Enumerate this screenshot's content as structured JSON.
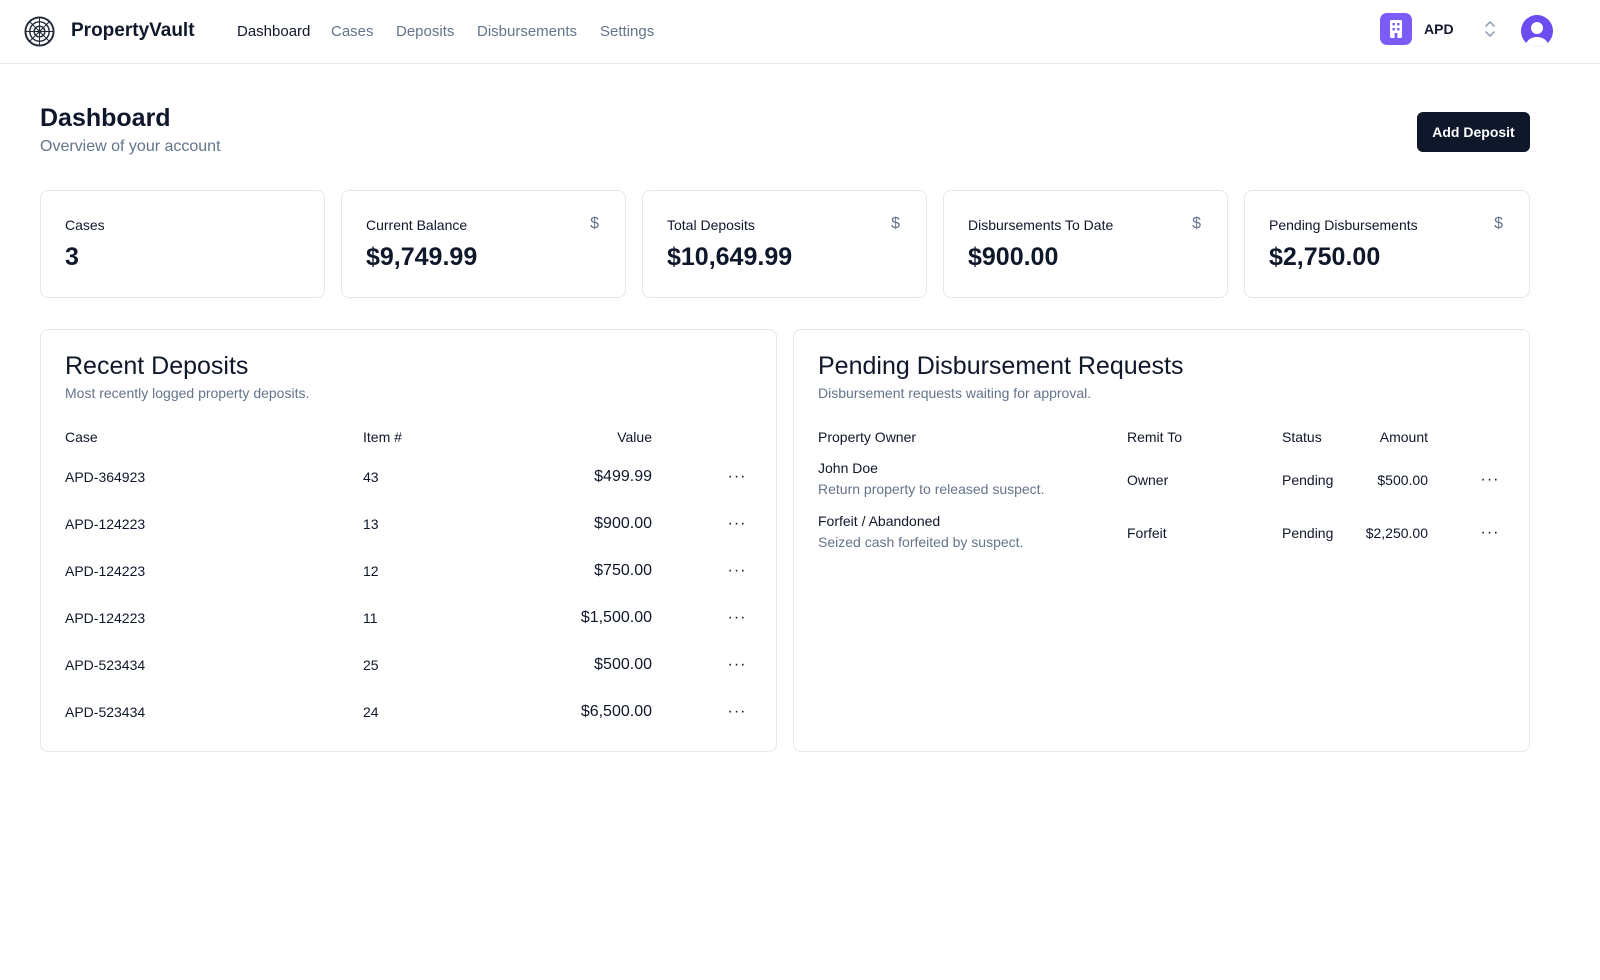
{
  "app": {
    "brand": "PropertyVault"
  },
  "nav": [
    {
      "label": "Dashboard"
    },
    {
      "label": "Cases"
    },
    {
      "label": "Deposits"
    },
    {
      "label": "Disbursements"
    },
    {
      "label": "Settings"
    }
  ],
  "org": {
    "name": "APD",
    "icon": "building-icon"
  },
  "page": {
    "title": "Dashboard",
    "subtitle": "Overview of your account",
    "add_button": "Add Deposit"
  },
  "stats": [
    {
      "label": "Cases",
      "value": "3"
    },
    {
      "label": "Current Balance",
      "value": "$9,749.99",
      "icon": "$"
    },
    {
      "label": "Total Deposits",
      "value": "$10,649.99",
      "icon": "$"
    },
    {
      "label": "Disbursements To Date",
      "value": "$900.00",
      "icon": "$"
    },
    {
      "label": "Pending Disbursements",
      "value": "$2,750.00",
      "icon": "$"
    }
  ],
  "recent_deposits": {
    "title": "Recent Deposits",
    "subtitle": "Most recently logged property deposits.",
    "columns": {
      "case": "Case",
      "item": "Item #",
      "value": "Value"
    },
    "rows": [
      {
        "case": "APD-364923",
        "item": "43",
        "value": "$499.99"
      },
      {
        "case": "APD-124223",
        "item": "13",
        "value": "$900.00"
      },
      {
        "case": "APD-124223",
        "item": "12",
        "value": "$750.00"
      },
      {
        "case": "APD-124223",
        "item": "11",
        "value": "$1,500.00"
      },
      {
        "case": "APD-523434",
        "item": "25",
        "value": "$500.00"
      },
      {
        "case": "APD-523434",
        "item": "24",
        "value": "$6,500.00"
      }
    ],
    "action_glyph": "···"
  },
  "pending_requests": {
    "title": "Pending Disbursement Requests",
    "subtitle": "Disbursement requests waiting for approval.",
    "columns": {
      "owner": "Property Owner",
      "remit": "Remit To",
      "status": "Status",
      "amount": "Amount"
    },
    "rows": [
      {
        "owner": "John Doe",
        "note": "Return property to released suspect.",
        "remit": "Owner",
        "status": "Pending",
        "amount": "$500.00"
      },
      {
        "owner": "Forfeit / Abandoned",
        "note": "Seized cash forfeited by suspect.",
        "remit": "Forfeit",
        "status": "Pending",
        "amount": "$2,250.00"
      }
    ],
    "action_glyph": "···"
  },
  "colors": {
    "primary": "#0f172a",
    "muted": "#64748b",
    "border": "#e5e7eb",
    "org_accent": "#7c5cf6",
    "avatar_accent": "#6d4cf0"
  }
}
